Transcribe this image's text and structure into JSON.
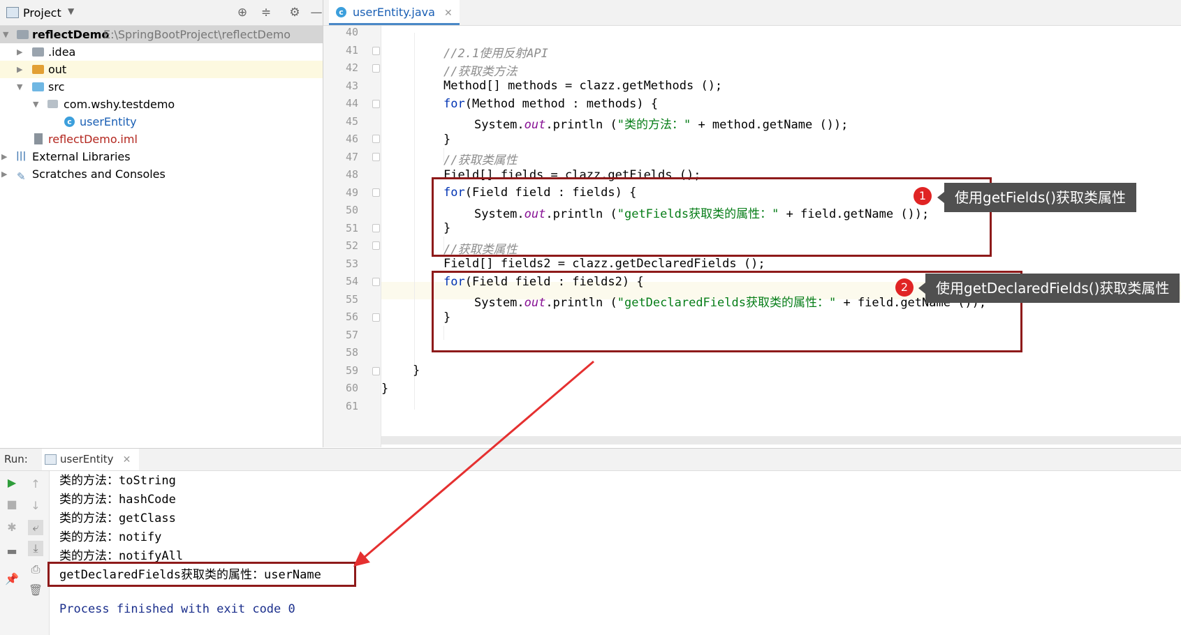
{
  "project": {
    "title": "Project",
    "tree": [
      {
        "label": "reflectDemo",
        "path": "E:\\SpringBootProject\\reflectDemo"
      },
      {
        "label": ".idea"
      },
      {
        "label": "out"
      },
      {
        "label": "src"
      },
      {
        "label": "com.wshy.testdemo"
      },
      {
        "label": "userEntity"
      },
      {
        "label": "reflectDemo.iml"
      },
      {
        "label": "External Libraries"
      },
      {
        "label": "Scratches and Consoles"
      }
    ]
  },
  "editor": {
    "tab": "userEntity.java",
    "line_numbers": [
      "40",
      "41",
      "42",
      "43",
      "44",
      "45",
      "46",
      "47",
      "48",
      "49",
      "50",
      "51",
      "52",
      "53",
      "54",
      "55",
      "56",
      "57",
      "58",
      "59",
      "60",
      "61"
    ],
    "code": {
      "l41": "//2.1使用反射API",
      "l42": "//获取类方法",
      "l43": "Method[] methods = clazz.getMethods ();",
      "l44_kw": "for",
      "l44": "(Method method : methods) {",
      "l45_a": "System.",
      "l45_out": "out",
      "l45_b": ".println (",
      "l45_str": "\"类的方法：\"",
      "l45_c": " + method.getName ());",
      "brace": "}",
      "l47": "//获取类属性",
      "l48": "Field[] fields = clazz.getFields ();",
      "l49_kw": "for",
      "l49": "(Field field : fields) {",
      "l50_a": "System.",
      "l50_out": "out",
      "l50_b": ".println (",
      "l50_str": "\"getFields获取类的属性：\"",
      "l50_c": " + field.getName ());",
      "l52": "//获取类属性",
      "l53": "Field[] fields2 = clazz.getDeclaredFields ();",
      "l54_kw": "for",
      "l54": "(Field field : fields2) {",
      "l55_a": "System.",
      "l55_out": "out",
      "l55_b": ".println (",
      "l55_str": "\"getDeclaredFields获取类的属性：\"",
      "l55_c": " + field.getName ());"
    }
  },
  "annotations": [
    {
      "number": "1",
      "text": "使用getFields()获取类属性"
    },
    {
      "number": "2",
      "text": "使用getDeclaredFields()获取类属性"
    }
  ],
  "run": {
    "label": "Run:",
    "tab": "userEntity",
    "output": [
      "类的方法：toString",
      "类的方法：hashCode",
      "类的方法：getClass",
      "类的方法：notify",
      "类的方法：notifyAll",
      "getDeclaredFields获取类的属性：userName",
      "",
      "Process finished with exit code 0"
    ]
  },
  "colors": {
    "keyword": "#0033b3",
    "string": "#067d17",
    "comment": "#8c8c8c",
    "static_field": "#871094",
    "annotation_box": "#8e1a1a",
    "badge": "#e02424",
    "arrow": "#e53030"
  }
}
